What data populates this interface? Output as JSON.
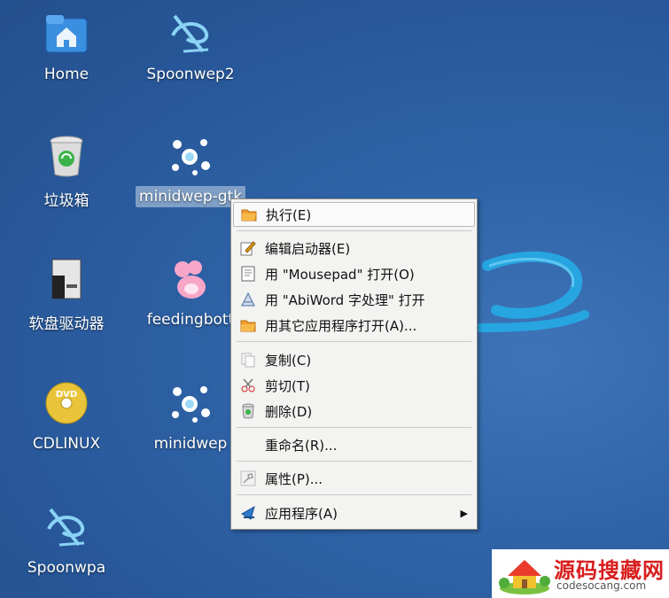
{
  "desktop": {
    "icons": [
      {
        "label": "Home",
        "icon": "home-folder-icon"
      },
      {
        "label": "Spoonwep2",
        "icon": "spoonwep-logo-icon"
      },
      {
        "label": "垃圾箱",
        "icon": "trash-icon"
      },
      {
        "label": "minidwep-gtk",
        "icon": "minidwep-splash-icon"
      },
      {
        "label": "软盘驱动器",
        "icon": "floppy-drive-icon"
      },
      {
        "label": "feedingbott",
        "icon": "feeding-bottle-icon"
      },
      {
        "label": "CDLINUX",
        "icon": "dvd-disc-icon"
      },
      {
        "label": "minidwep",
        "icon": "minidwep-splash-icon"
      },
      {
        "label": "Spoonwpa",
        "icon": "spoonwep-logo-icon"
      }
    ]
  },
  "context_menu": {
    "items": [
      {
        "label": "执行(E)",
        "icon": "open-folder-icon"
      },
      {
        "label": "编辑启动器(E)",
        "icon": "edit-launcher-icon"
      },
      {
        "label": "用 \"Mousepad\" 打开(O)",
        "icon": "text-editor-icon"
      },
      {
        "label": "用 \"AbiWord 字处理\" 打开",
        "icon": "abiword-icon"
      },
      {
        "label": "用其它应用程序打开(A)...",
        "icon": "open-folder-icon"
      },
      {
        "label": "复制(C)",
        "icon": "copy-icon"
      },
      {
        "label": "剪切(T)",
        "icon": "scissors-icon"
      },
      {
        "label": "删除(D)",
        "icon": "trash-icon"
      },
      {
        "label": "重命名(R)..."
      },
      {
        "label": "属性(P)...",
        "icon": "properties-icon"
      },
      {
        "label": "应用程序(A)",
        "icon": "applications-icon"
      }
    ]
  },
  "watermark": {
    "title": "源码搜藏网",
    "url": "codesocang.com"
  }
}
